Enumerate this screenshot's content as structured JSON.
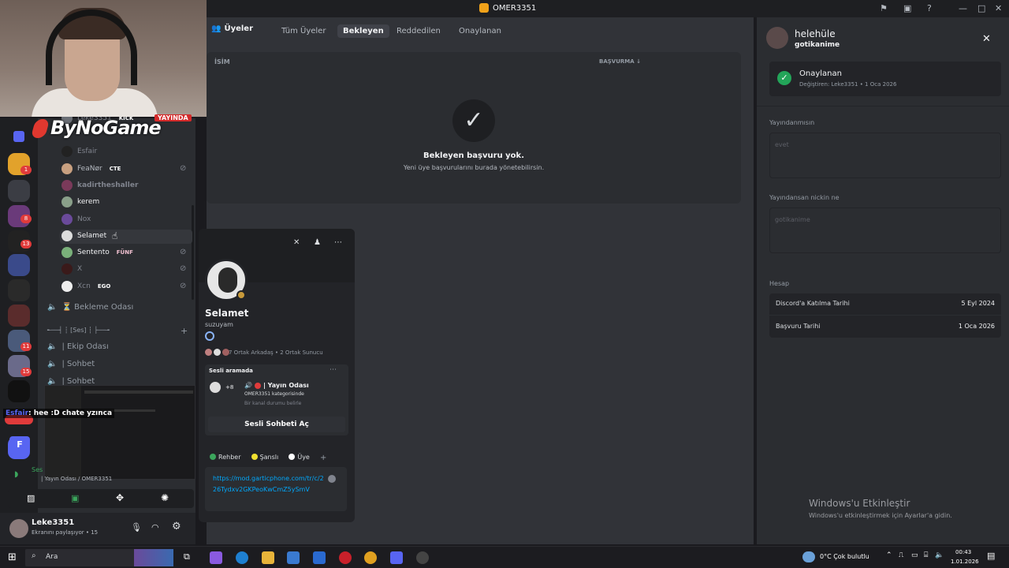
{
  "window": {
    "title": "OMER3351"
  },
  "stream": {
    "brand": "ByNoGame",
    "live_label": "YAYINDA"
  },
  "server_badges": [
    "1",
    "8",
    "13",
    "11",
    "15"
  ],
  "voice_users": [
    {
      "name": "Leke3351",
      "tag": "KICK",
      "muted": true
    },
    {
      "name": "Esfair",
      "tag": "",
      "muted": false
    },
    {
      "name": "FeaNør",
      "tag": "CTE",
      "muted": true
    },
    {
      "name": "kadirtheshaller",
      "tag": "",
      "muted": false
    },
    {
      "name": "kerem",
      "tag": "",
      "muted": false
    },
    {
      "name": "Nox",
      "tag": "",
      "muted": false
    },
    {
      "name": "Selamet",
      "tag": "",
      "muted": false
    },
    {
      "name": "Sentento",
      "tag": "FÜNF",
      "muted": true
    },
    {
      "name": "X",
      "tag": "",
      "muted": true
    },
    {
      "name": "Xcn",
      "tag": "EGO",
      "muted": true
    }
  ],
  "channels": {
    "waiting": "⏳ Bekleme Odası",
    "category": "╾──┤ ┆ [Ses] ┆ ├──╼",
    "ekip": "| Ekip Odası",
    "sohbet": "| Sohbet",
    "sohbet2": "| Sohbet"
  },
  "overlay_chat": {
    "user": "Esfair",
    "message": ": hee :D chate yzınca"
  },
  "voice_status": {
    "label": "Ses",
    "channel": "| Yayın Odası / OMER3351"
  },
  "user_panel": {
    "name": "Leke3351",
    "status": "Ekranını paylaşıyor • 15"
  },
  "members": {
    "header": "Üyeler",
    "tabs": [
      "Tüm Üyeler",
      "Bekleyen",
      "Reddedilen",
      "Onaylanan"
    ],
    "active_tab": "Bekleyen",
    "col_name": "İSİM",
    "col_sort": "BAŞVURMA",
    "empty_title": "Bekleyen başvuru yok.",
    "empty_sub": "Yeni üye başvurularını burada yönetebilirsin."
  },
  "profile": {
    "display": "Selamet",
    "username": "suzuyam",
    "mutuals": "7 Ortak Arkadaş  •  2 Ortak Sunucu",
    "voice_header": "Sesli aramada",
    "voice_channel": "| Yayın Odası",
    "voice_count": "+8",
    "voice_category": "OMER3351 kategorisinde",
    "voice_status_ph": "Bir kanal durumu belirle",
    "voice_button": "Sesli Sohbeti Aç",
    "roles": [
      {
        "name": "Rehber",
        "color": "#3ba55c"
      },
      {
        "name": "Şanslı",
        "color": "#f0e030"
      },
      {
        "name": "Üye",
        "color": "#ffffff"
      }
    ],
    "link": "https://mod.garticphone.com/tr/c/226Tydxv2GKPeoKwCmZ5ySmV"
  },
  "detail": {
    "name": "helehüle",
    "username": "gotikanime",
    "status": "Onaylanan",
    "changed_by": "Değiştiren: Leke3351  •  1 Oca 2026",
    "q1": "Yayındanmısın",
    "a1": "evet",
    "q2": "Yayındansan nickin ne",
    "a2": "gotikanime",
    "account_label": "Hesap",
    "join_label": "Discord'a Katılma Tarihi",
    "join_value": "5 Eyl 2024",
    "apply_label": "Başvuru Tarihi",
    "apply_value": "1 Oca 2026"
  },
  "watermark": {
    "title": "Windows'u Etkinleştir",
    "sub": "Windows'u etkinleştirmek için Ayarlar'a gidin."
  },
  "taskbar": {
    "search": "Ara",
    "weather": "0°C  Çok bulutlu",
    "time": "00:43",
    "date": "1.01.2026"
  }
}
